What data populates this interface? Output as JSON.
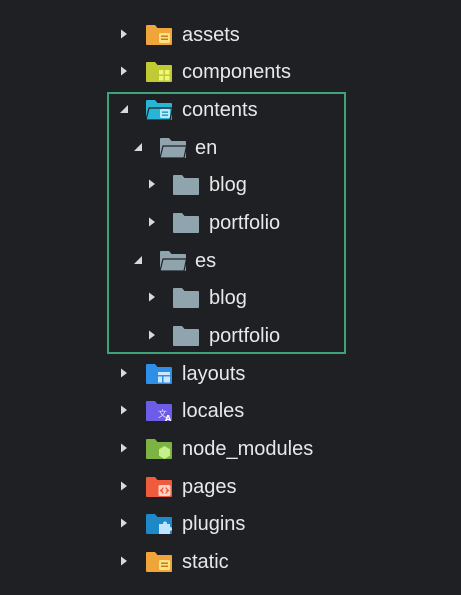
{
  "explorer": {
    "items": [
      {
        "label": "assets",
        "expanded": false,
        "icon": "folder-assets-icon",
        "color": "#f0a53a",
        "badge": "#ffe082"
      },
      {
        "label": "components",
        "expanded": false,
        "icon": "folder-components-icon",
        "color": "#c0ca33",
        "badge": "#eef77a"
      },
      {
        "label": "contents",
        "expanded": true,
        "icon": "folder-contents-open-icon",
        "color": "#29b6d6",
        "badge": "#b3ecff"
      },
      {
        "label": "en",
        "expanded": true,
        "icon": "folder-open-icon",
        "color": "#90a4ae"
      },
      {
        "label": "blog",
        "expanded": false,
        "icon": "folder-icon",
        "color": "#90a4ae"
      },
      {
        "label": "portfolio",
        "expanded": false,
        "icon": "folder-icon",
        "color": "#90a4ae"
      },
      {
        "label": "es",
        "expanded": true,
        "icon": "folder-open-icon",
        "color": "#90a4ae"
      },
      {
        "label": "blog",
        "expanded": false,
        "icon": "folder-icon",
        "color": "#90a4ae"
      },
      {
        "label": "portfolio",
        "expanded": false,
        "icon": "folder-icon",
        "color": "#90a4ae"
      },
      {
        "label": "layouts",
        "expanded": false,
        "icon": "folder-layouts-icon",
        "color": "#2d8fe8",
        "badge": "#cfe6ff"
      },
      {
        "label": "locales",
        "expanded": false,
        "icon": "folder-locales-icon",
        "color": "#6c5ce7",
        "badge": "#e5e0ff"
      },
      {
        "label": "node_modules",
        "expanded": false,
        "icon": "folder-node-modules-icon",
        "color": "#7cb342",
        "badge": "#c5f08a"
      },
      {
        "label": "pages",
        "expanded": false,
        "icon": "folder-pages-icon",
        "color": "#ef5b3c",
        "badge": "#ffd3c6"
      },
      {
        "label": "plugins",
        "expanded": false,
        "icon": "folder-plugins-icon",
        "color": "#1e88c8",
        "badge": "#bfe4ff"
      },
      {
        "label": "static",
        "expanded": false,
        "icon": "folder-static-icon",
        "color": "#f0a53a",
        "badge": "#ffe082"
      }
    ]
  },
  "colors": {
    "background": "#1f2024",
    "text": "#e8e8e8",
    "arrow": "#d9d9d9",
    "highlight": "#3fa37a"
  }
}
